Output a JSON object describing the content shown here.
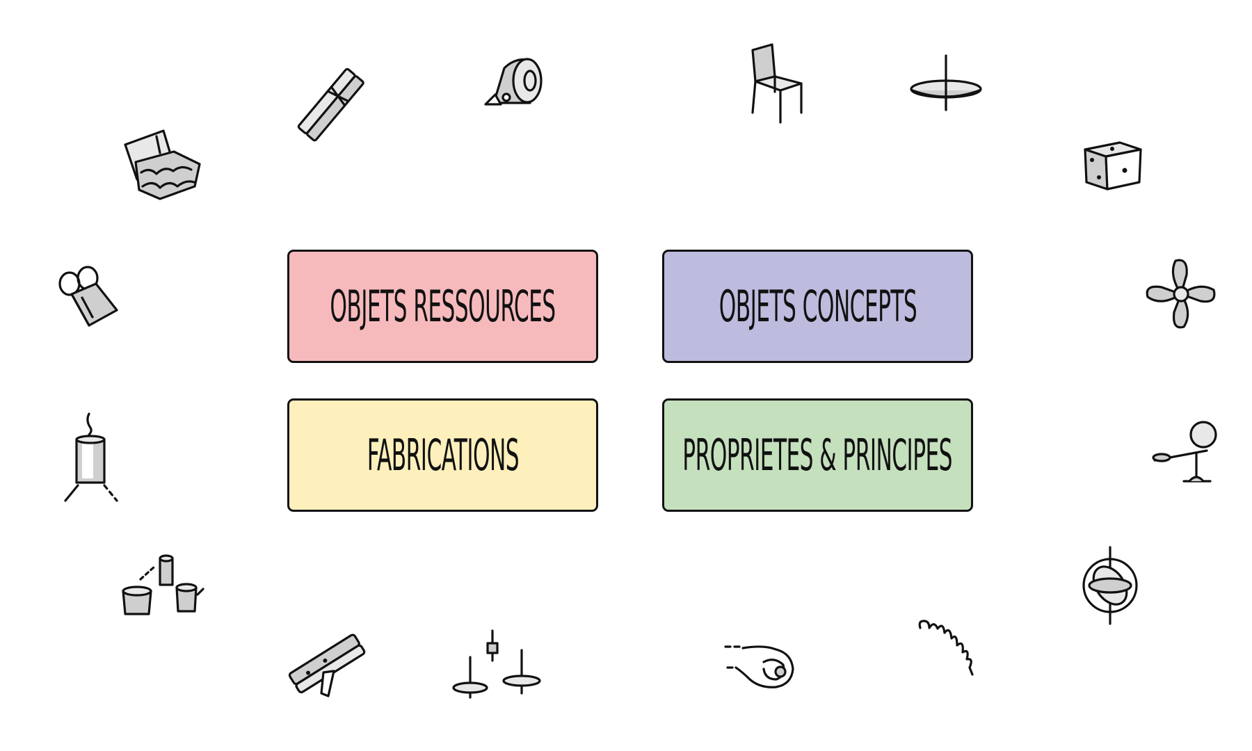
{
  "cards": {
    "ressources": {
      "label": "OBJETS RESSOURCES",
      "color": "#f6babd"
    },
    "concepts": {
      "label": "OBJETS CONCEPTS",
      "color": "#bdbcde"
    },
    "fabrications": {
      "label": "FABRICATIONS",
      "color": "#fdf0bd"
    },
    "proprietes": {
      "label": "PROPRIETES & PRINCIPES",
      "color": "#c5e0bd"
    }
  },
  "icons": [
    "clothespin-icon",
    "tape-measure-icon",
    "chair-icon",
    "spinning-top-disc-icon",
    "egg-carton-icon",
    "dice-icon",
    "binder-clip-icon",
    "propeller-icon",
    "candle-can-icon",
    "balance-scale-icon",
    "tin-can-phone-icon",
    "gyroscope-icon",
    "clothespin-launcher-icon",
    "spinning-tops-icon",
    "hand-marble-icon",
    "spring-icon"
  ]
}
